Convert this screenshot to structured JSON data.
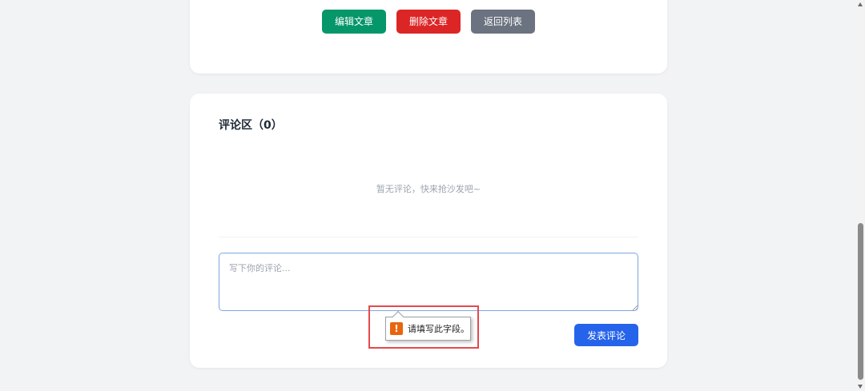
{
  "actions": {
    "edit_label": "编辑文章",
    "delete_label": "删除文章",
    "back_label": "返回列表"
  },
  "comments": {
    "title": "评论区（0）",
    "empty_text": "暂无评论，快来抢沙发吧~",
    "input_placeholder": "写下你的评论...",
    "input_value": "",
    "submit_label": "发表评论"
  },
  "validation": {
    "icon": "warning-icon",
    "message": "请填写此字段。"
  },
  "colors": {
    "edit": "#059669",
    "delete": "#dc2626",
    "back": "#6b7280",
    "submit": "#2563eb",
    "warning": "#e8650f",
    "highlight": "#e5484d"
  }
}
